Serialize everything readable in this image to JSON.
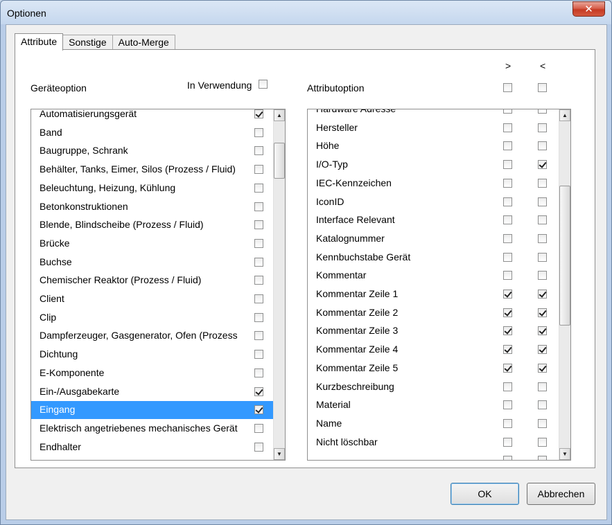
{
  "window": {
    "title": "Optionen",
    "close_glyph": "✕"
  },
  "tabs": [
    {
      "label": "Attribute",
      "active": true
    },
    {
      "label": "Sonstige",
      "active": false
    },
    {
      "label": "Auto-Merge",
      "active": false
    }
  ],
  "left": {
    "header": "Geräteoption",
    "in_use_label": "In Verwendung",
    "in_use_checked": false,
    "items": [
      {
        "label": "Automatisierungsgerät",
        "checked": true
      },
      {
        "label": "Band",
        "checked": false
      },
      {
        "label": "Baugruppe, Schrank",
        "checked": false
      },
      {
        "label": "Behälter, Tanks, Eimer, Silos (Prozess / Fluid)",
        "checked": false
      },
      {
        "label": "Beleuchtung, Heizung, Kühlung",
        "checked": false
      },
      {
        "label": "Betonkonstruktionen",
        "checked": false
      },
      {
        "label": "Blende, Blindscheibe (Prozess / Fluid)",
        "checked": false
      },
      {
        "label": "Brücke",
        "checked": false
      },
      {
        "label": "Buchse",
        "checked": false
      },
      {
        "label": "Chemischer Reaktor (Prozess / Fluid)",
        "checked": false
      },
      {
        "label": "Client",
        "checked": false
      },
      {
        "label": "Clip",
        "checked": false
      },
      {
        "label": "Dampferzeuger, Gasgenerator, Ofen (Prozess",
        "checked": false
      },
      {
        "label": "Dichtung",
        "checked": false
      },
      {
        "label": "E-Komponente",
        "checked": false
      },
      {
        "label": "Ein-/Ausgabekarte",
        "checked": true
      },
      {
        "label": "Eingang",
        "checked": true,
        "selected": true
      },
      {
        "label": "Elektrisch angetriebenes mechanisches Gerät",
        "checked": false
      },
      {
        "label": "Endhalter",
        "checked": false
      }
    ]
  },
  "right": {
    "header": "Attributoption",
    "col_gt_label": ">",
    "col_lt_label": "<",
    "col_gt_all": false,
    "col_lt_all": false,
    "items": [
      {
        "label": "Hardware Adresse",
        "gt": false,
        "lt": false
      },
      {
        "label": "Hersteller",
        "gt": false,
        "lt": false
      },
      {
        "label": "Höhe",
        "gt": false,
        "lt": false
      },
      {
        "label": "I/O-Typ",
        "gt": false,
        "lt": true
      },
      {
        "label": "IEC-Kennzeichen",
        "gt": false,
        "lt": false
      },
      {
        "label": "IconID",
        "gt": false,
        "lt": false
      },
      {
        "label": "Interface Relevant",
        "gt": false,
        "lt": false
      },
      {
        "label": "Katalognummer",
        "gt": false,
        "lt": false
      },
      {
        "label": "Kennbuchstabe Gerät",
        "gt": false,
        "lt": false
      },
      {
        "label": "Kommentar",
        "gt": false,
        "lt": false
      },
      {
        "label": "Kommentar Zeile 1",
        "gt": true,
        "lt": true
      },
      {
        "label": "Kommentar Zeile 2",
        "gt": true,
        "lt": true
      },
      {
        "label": "Kommentar Zeile 3",
        "gt": true,
        "lt": true
      },
      {
        "label": "Kommentar Zeile 4",
        "gt": true,
        "lt": true
      },
      {
        "label": "Kommentar Zeile 5",
        "gt": true,
        "lt": true
      },
      {
        "label": "Kurzbeschreibung",
        "gt": false,
        "lt": false
      },
      {
        "label": "Material",
        "gt": false,
        "lt": false
      },
      {
        "label": "Name",
        "gt": false,
        "lt": false
      },
      {
        "label": "Nicht löschbar",
        "gt": false,
        "lt": false
      },
      {
        "label": "",
        "gt": false,
        "lt": false
      }
    ]
  },
  "buttons": {
    "ok": "OK",
    "cancel": "Abbrechen"
  }
}
